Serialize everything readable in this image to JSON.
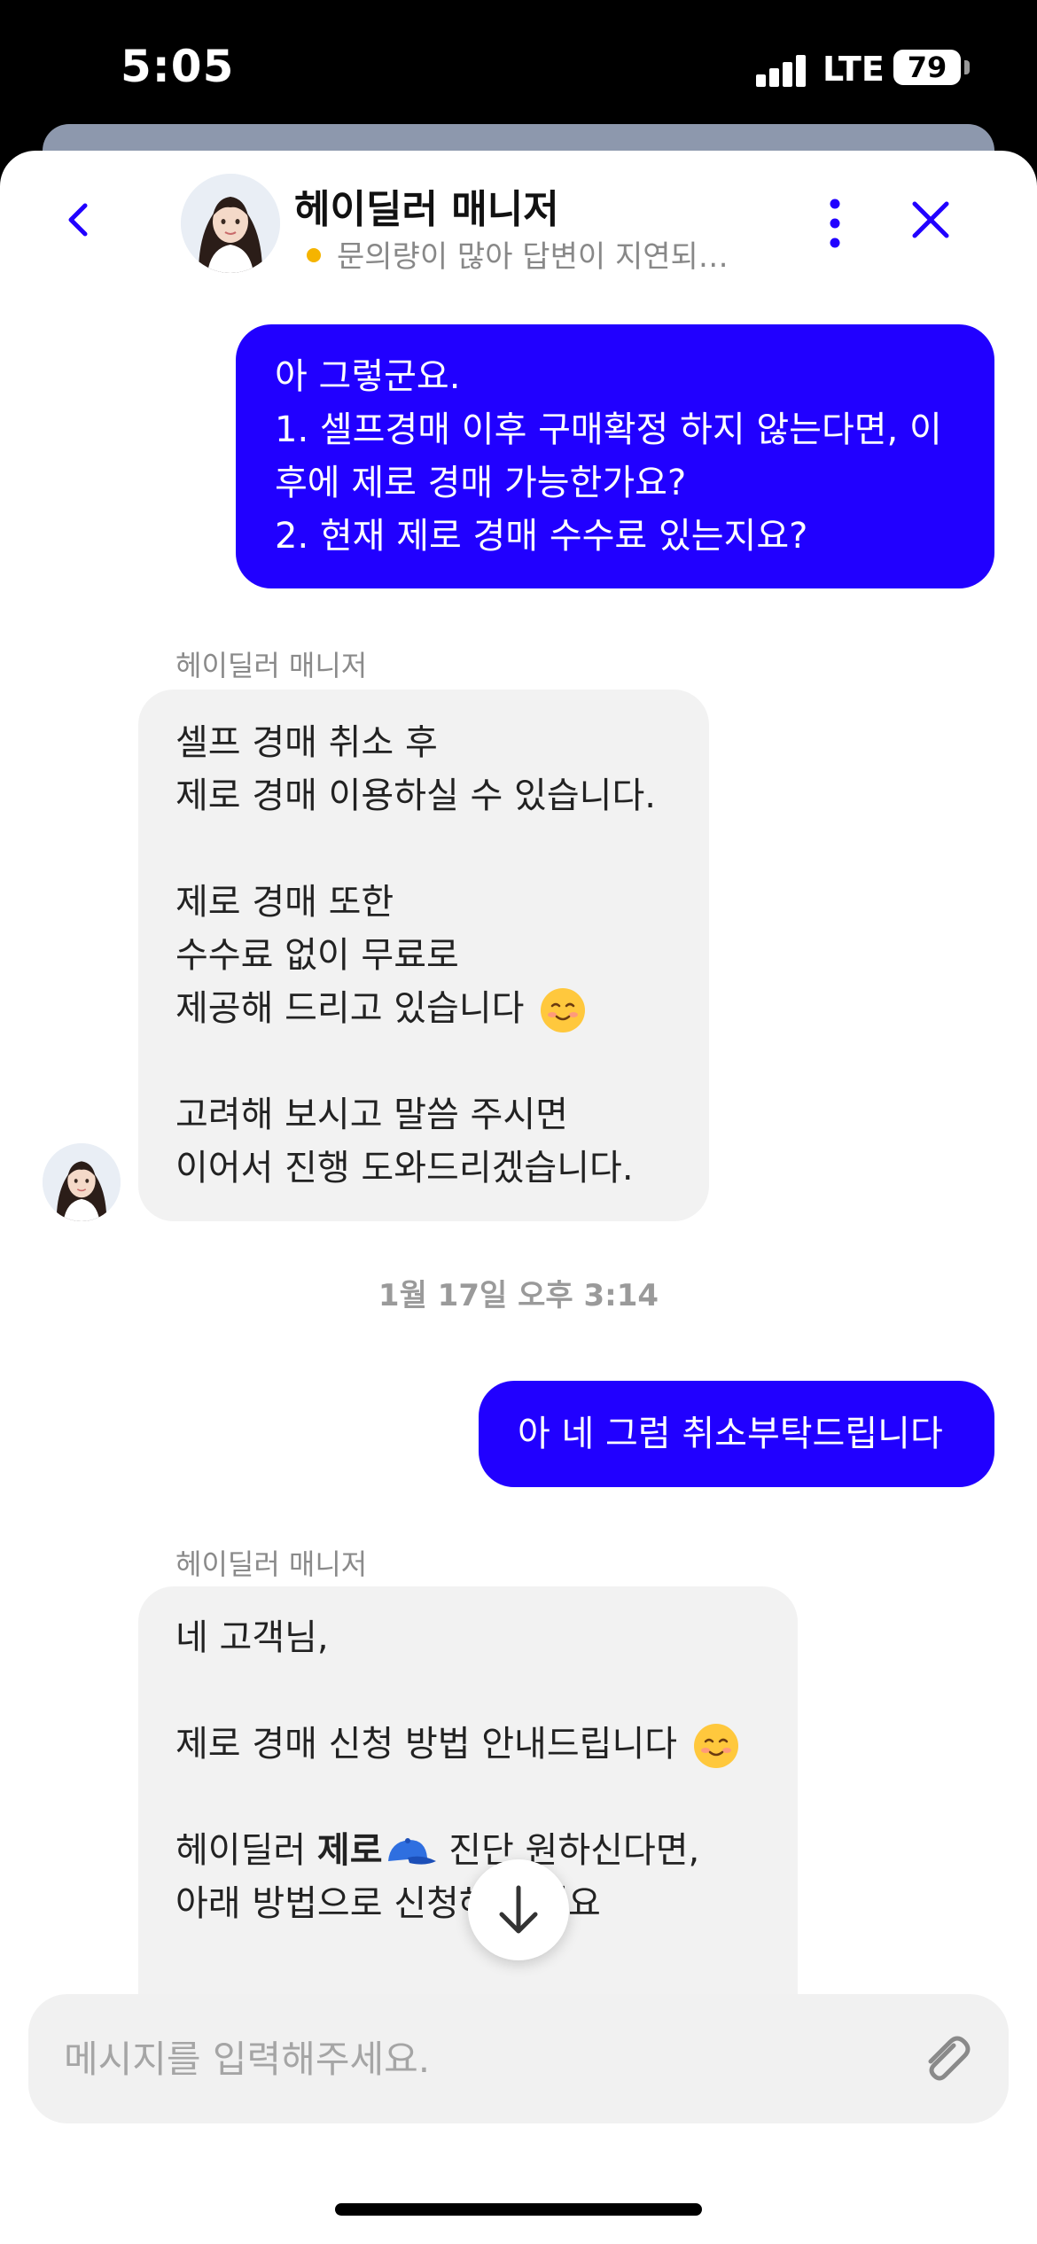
{
  "status_bar": {
    "time": "5:05",
    "network": "LTE",
    "battery": "79"
  },
  "header": {
    "title": "헤이딜러 매니저",
    "subtitle": "문의량이 많아 답변이 지연되…",
    "status_color": "#f5b400",
    "back_icon": "chevron-left-icon",
    "more_icon": "more-vertical-icon",
    "close_icon": "close-icon"
  },
  "colors": {
    "accent": "#2100ff",
    "incoming_bubble": "#f2f2f2"
  },
  "messages": {
    "m1": {
      "lines": [
        "아 그렇군요.",
        "1. 셀프경매 이후 구매확정 하지 않는다면, 이",
        "후에 제로 경매 가능한가요?",
        "2. 현재 제로 경매 수수료 있는지요?"
      ]
    },
    "m2": {
      "sender": "헤이딜러 매니저",
      "lines": [
        "셀프 경매 취소 후",
        "제로 경매 이용하실 수 있습니다.",
        "",
        "제로 경매 또한",
        "수수료 없이 무료로",
        "제공해 드리고 있습니다",
        "",
        "고려해 보시고 말씀 주시면",
        "이어서 진행 도와드리겠습니다."
      ]
    },
    "timestamp": "1월 17일 오후 3:14",
    "m3": {
      "text": "아 네 그럼 취소부탁드립니다"
    },
    "m4": {
      "sender": "헤이딜러 매니저",
      "line1": "네 고객님,",
      "line2": "제로 경매 신청 방법 안내드립니다",
      "line3_prefix": "헤이딜러 ",
      "line3_bold": "제로",
      "line3_suffix": " 진단 원하신다면,",
      "line4": "아래 방법으로 신청해 주세요"
    }
  },
  "composer": {
    "placeholder": "메시지를 입력해주세요.",
    "attach_icon": "paperclip-icon"
  },
  "scroll_button_icon": "arrow-down-icon"
}
